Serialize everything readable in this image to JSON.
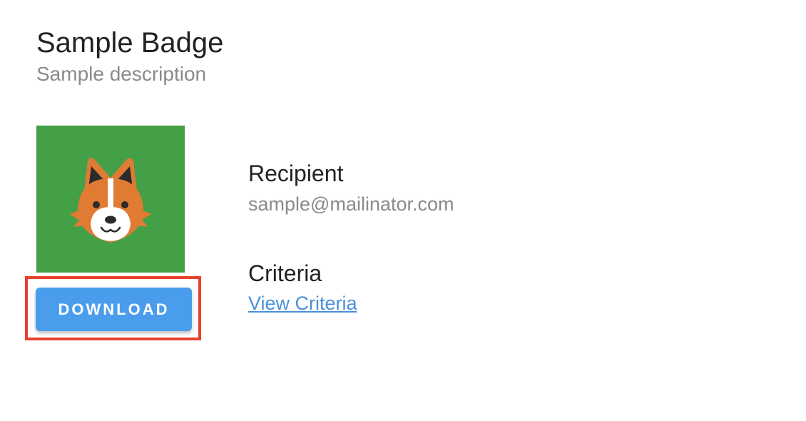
{
  "badge": {
    "title": "Sample Badge",
    "description": "Sample description",
    "image_icon": "corgi-dog-icon",
    "image_background_color": "#43a047"
  },
  "actions": {
    "download_label": "DOWNLOAD",
    "download_color": "#4a9ded"
  },
  "highlight": {
    "color": "#e8412b"
  },
  "recipient": {
    "label": "Recipient",
    "value": "sample@mailinator.com"
  },
  "criteria": {
    "label": "Criteria",
    "link_text": "View Criteria",
    "link_color": "#4a90d9"
  }
}
